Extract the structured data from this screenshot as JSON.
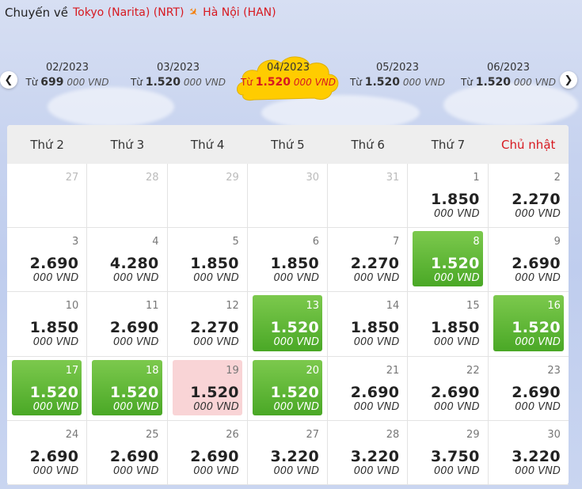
{
  "header": {
    "label": "Chuyến về",
    "origin": "Tokyo (Narita) (NRT)",
    "plane_icon": "airplane-icon",
    "destination": "Hà Nội (HAN)"
  },
  "months": [
    {
      "month": "02/2023",
      "prefix": "Từ",
      "price": "699",
      "unit": "000 VND"
    },
    {
      "month": "03/2023",
      "prefix": "Từ",
      "price": "1.520",
      "unit": "000 VND"
    },
    {
      "month": "04/2023",
      "prefix": "Từ",
      "price": "1.520",
      "unit": "000 VND"
    },
    {
      "month": "05/2023",
      "prefix": "Từ",
      "price": "1.520",
      "unit": "000 VND"
    },
    {
      "month": "06/2023",
      "prefix": "Từ",
      "price": "1.520",
      "unit": "000 VND"
    }
  ],
  "weekdays": [
    "Thứ 2",
    "Thứ 3",
    "Thứ 4",
    "Thứ 5",
    "Thứ 6",
    "Thứ 7",
    "Chủ nhật"
  ],
  "colors": {
    "accent": "#d71920",
    "cheap": "#5cb533",
    "selected": "#f9d4d6",
    "active_month": "#ffcc00"
  },
  "days": [
    {
      "day": "27",
      "price": "",
      "unit": "",
      "state": "muted"
    },
    {
      "day": "28",
      "price": "",
      "unit": "",
      "state": "muted"
    },
    {
      "day": "29",
      "price": "",
      "unit": "",
      "state": "muted"
    },
    {
      "day": "30",
      "price": "",
      "unit": "",
      "state": "muted"
    },
    {
      "day": "31",
      "price": "",
      "unit": "",
      "state": "muted"
    },
    {
      "day": "1",
      "price": "1.850",
      "unit": "000 VND",
      "state": ""
    },
    {
      "day": "2",
      "price": "2.270",
      "unit": "000 VND",
      "state": ""
    },
    {
      "day": "3",
      "price": "2.690",
      "unit": "000 VND",
      "state": ""
    },
    {
      "day": "4",
      "price": "4.280",
      "unit": "000 VND",
      "state": ""
    },
    {
      "day": "5",
      "price": "1.850",
      "unit": "000 VND",
      "state": ""
    },
    {
      "day": "6",
      "price": "1.850",
      "unit": "000 VND",
      "state": ""
    },
    {
      "day": "7",
      "price": "2.270",
      "unit": "000 VND",
      "state": ""
    },
    {
      "day": "8",
      "price": "1.520",
      "unit": "000 VND",
      "state": "cheap"
    },
    {
      "day": "9",
      "price": "2.690",
      "unit": "000 VND",
      "state": ""
    },
    {
      "day": "10",
      "price": "1.850",
      "unit": "000 VND",
      "state": ""
    },
    {
      "day": "11",
      "price": "2.690",
      "unit": "000 VND",
      "state": ""
    },
    {
      "day": "12",
      "price": "2.270",
      "unit": "000 VND",
      "state": ""
    },
    {
      "day": "13",
      "price": "1.520",
      "unit": "000 VND",
      "state": "cheap"
    },
    {
      "day": "14",
      "price": "1.850",
      "unit": "000 VND",
      "state": ""
    },
    {
      "day": "15",
      "price": "1.850",
      "unit": "000 VND",
      "state": ""
    },
    {
      "day": "16",
      "price": "1.520",
      "unit": "000 VND",
      "state": "cheap"
    },
    {
      "day": "17",
      "price": "1.520",
      "unit": "000 VND",
      "state": "cheap"
    },
    {
      "day": "18",
      "price": "1.520",
      "unit": "000 VND",
      "state": "cheap"
    },
    {
      "day": "19",
      "price": "1.520",
      "unit": "000 VND",
      "state": "sel"
    },
    {
      "day": "20",
      "price": "1.520",
      "unit": "000 VND",
      "state": "cheap"
    },
    {
      "day": "21",
      "price": "2.690",
      "unit": "000 VND",
      "state": ""
    },
    {
      "day": "22",
      "price": "2.690",
      "unit": "000 VND",
      "state": ""
    },
    {
      "day": "23",
      "price": "2.690",
      "unit": "000 VND",
      "state": ""
    },
    {
      "day": "24",
      "price": "2.690",
      "unit": "000 VND",
      "state": ""
    },
    {
      "day": "25",
      "price": "2.690",
      "unit": "000 VND",
      "state": ""
    },
    {
      "day": "26",
      "price": "2.690",
      "unit": "000 VND",
      "state": ""
    },
    {
      "day": "27",
      "price": "3.220",
      "unit": "000 VND",
      "state": ""
    },
    {
      "day": "28",
      "price": "3.220",
      "unit": "000 VND",
      "state": ""
    },
    {
      "day": "29",
      "price": "3.750",
      "unit": "000 VND",
      "state": ""
    },
    {
      "day": "30",
      "price": "3.220",
      "unit": "000 VND",
      "state": ""
    }
  ]
}
